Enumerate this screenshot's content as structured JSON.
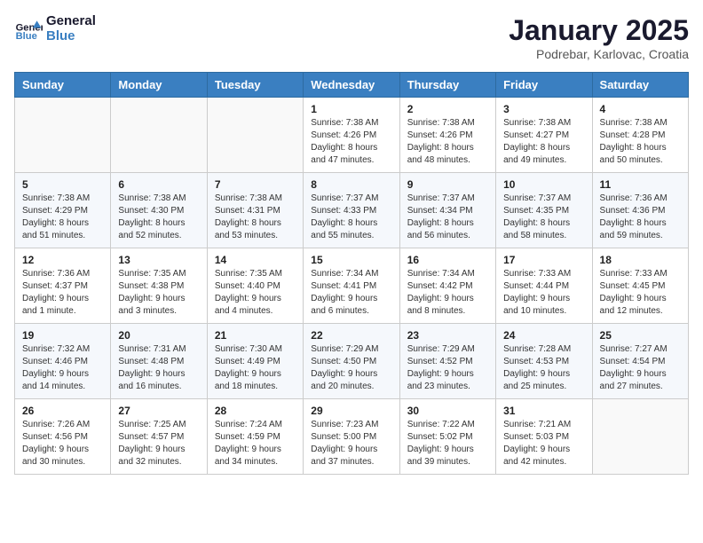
{
  "logo": {
    "text_general": "General",
    "text_blue": "Blue"
  },
  "header": {
    "title": "January 2025",
    "subtitle": "Podrebar, Karlovac, Croatia"
  },
  "days_of_week": [
    "Sunday",
    "Monday",
    "Tuesday",
    "Wednesday",
    "Thursday",
    "Friday",
    "Saturday"
  ],
  "weeks": [
    [
      {
        "day": "",
        "info": ""
      },
      {
        "day": "",
        "info": ""
      },
      {
        "day": "",
        "info": ""
      },
      {
        "day": "1",
        "info": "Sunrise: 7:38 AM\nSunset: 4:26 PM\nDaylight: 8 hours\nand 47 minutes."
      },
      {
        "day": "2",
        "info": "Sunrise: 7:38 AM\nSunset: 4:26 PM\nDaylight: 8 hours\nand 48 minutes."
      },
      {
        "day": "3",
        "info": "Sunrise: 7:38 AM\nSunset: 4:27 PM\nDaylight: 8 hours\nand 49 minutes."
      },
      {
        "day": "4",
        "info": "Sunrise: 7:38 AM\nSunset: 4:28 PM\nDaylight: 8 hours\nand 50 minutes."
      }
    ],
    [
      {
        "day": "5",
        "info": "Sunrise: 7:38 AM\nSunset: 4:29 PM\nDaylight: 8 hours\nand 51 minutes."
      },
      {
        "day": "6",
        "info": "Sunrise: 7:38 AM\nSunset: 4:30 PM\nDaylight: 8 hours\nand 52 minutes."
      },
      {
        "day": "7",
        "info": "Sunrise: 7:38 AM\nSunset: 4:31 PM\nDaylight: 8 hours\nand 53 minutes."
      },
      {
        "day": "8",
        "info": "Sunrise: 7:37 AM\nSunset: 4:33 PM\nDaylight: 8 hours\nand 55 minutes."
      },
      {
        "day": "9",
        "info": "Sunrise: 7:37 AM\nSunset: 4:34 PM\nDaylight: 8 hours\nand 56 minutes."
      },
      {
        "day": "10",
        "info": "Sunrise: 7:37 AM\nSunset: 4:35 PM\nDaylight: 8 hours\nand 58 minutes."
      },
      {
        "day": "11",
        "info": "Sunrise: 7:36 AM\nSunset: 4:36 PM\nDaylight: 8 hours\nand 59 minutes."
      }
    ],
    [
      {
        "day": "12",
        "info": "Sunrise: 7:36 AM\nSunset: 4:37 PM\nDaylight: 9 hours\nand 1 minute."
      },
      {
        "day": "13",
        "info": "Sunrise: 7:35 AM\nSunset: 4:38 PM\nDaylight: 9 hours\nand 3 minutes."
      },
      {
        "day": "14",
        "info": "Sunrise: 7:35 AM\nSunset: 4:40 PM\nDaylight: 9 hours\nand 4 minutes."
      },
      {
        "day": "15",
        "info": "Sunrise: 7:34 AM\nSunset: 4:41 PM\nDaylight: 9 hours\nand 6 minutes."
      },
      {
        "day": "16",
        "info": "Sunrise: 7:34 AM\nSunset: 4:42 PM\nDaylight: 9 hours\nand 8 minutes."
      },
      {
        "day": "17",
        "info": "Sunrise: 7:33 AM\nSunset: 4:44 PM\nDaylight: 9 hours\nand 10 minutes."
      },
      {
        "day": "18",
        "info": "Sunrise: 7:33 AM\nSunset: 4:45 PM\nDaylight: 9 hours\nand 12 minutes."
      }
    ],
    [
      {
        "day": "19",
        "info": "Sunrise: 7:32 AM\nSunset: 4:46 PM\nDaylight: 9 hours\nand 14 minutes."
      },
      {
        "day": "20",
        "info": "Sunrise: 7:31 AM\nSunset: 4:48 PM\nDaylight: 9 hours\nand 16 minutes."
      },
      {
        "day": "21",
        "info": "Sunrise: 7:30 AM\nSunset: 4:49 PM\nDaylight: 9 hours\nand 18 minutes."
      },
      {
        "day": "22",
        "info": "Sunrise: 7:29 AM\nSunset: 4:50 PM\nDaylight: 9 hours\nand 20 minutes."
      },
      {
        "day": "23",
        "info": "Sunrise: 7:29 AM\nSunset: 4:52 PM\nDaylight: 9 hours\nand 23 minutes."
      },
      {
        "day": "24",
        "info": "Sunrise: 7:28 AM\nSunset: 4:53 PM\nDaylight: 9 hours\nand 25 minutes."
      },
      {
        "day": "25",
        "info": "Sunrise: 7:27 AM\nSunset: 4:54 PM\nDaylight: 9 hours\nand 27 minutes."
      }
    ],
    [
      {
        "day": "26",
        "info": "Sunrise: 7:26 AM\nSunset: 4:56 PM\nDaylight: 9 hours\nand 30 minutes."
      },
      {
        "day": "27",
        "info": "Sunrise: 7:25 AM\nSunset: 4:57 PM\nDaylight: 9 hours\nand 32 minutes."
      },
      {
        "day": "28",
        "info": "Sunrise: 7:24 AM\nSunset: 4:59 PM\nDaylight: 9 hours\nand 34 minutes."
      },
      {
        "day": "29",
        "info": "Sunrise: 7:23 AM\nSunset: 5:00 PM\nDaylight: 9 hours\nand 37 minutes."
      },
      {
        "day": "30",
        "info": "Sunrise: 7:22 AM\nSunset: 5:02 PM\nDaylight: 9 hours\nand 39 minutes."
      },
      {
        "day": "31",
        "info": "Sunrise: 7:21 AM\nSunset: 5:03 PM\nDaylight: 9 hours\nand 42 minutes."
      },
      {
        "day": "",
        "info": ""
      }
    ]
  ]
}
